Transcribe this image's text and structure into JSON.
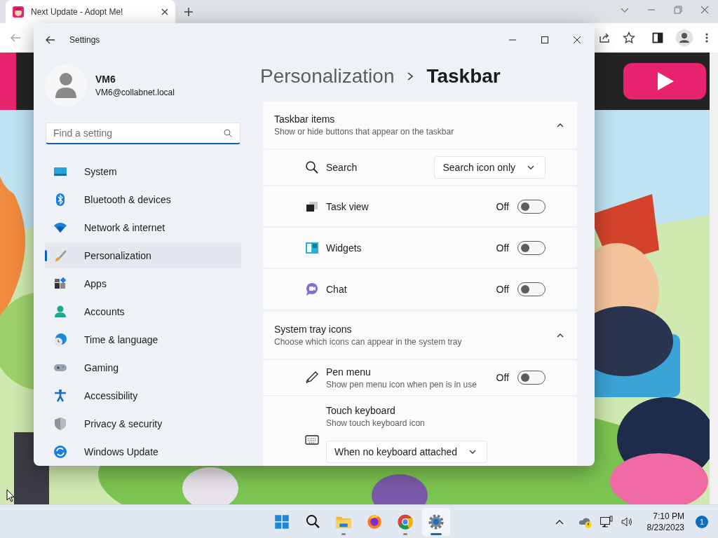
{
  "browser": {
    "tab": {
      "title": "Next Update - Adopt Me!",
      "selected": true
    }
  },
  "settings": {
    "title": "Settings",
    "account": {
      "name": "VM6",
      "email": "VM6@collabnet.local"
    },
    "search": {
      "placeholder": "Find a setting"
    },
    "nav": [
      {
        "label": "System",
        "selected": false
      },
      {
        "label": "Bluetooth & devices",
        "selected": false
      },
      {
        "label": "Network & internet",
        "selected": false
      },
      {
        "label": "Personalization",
        "selected": true
      },
      {
        "label": "Apps",
        "selected": false
      },
      {
        "label": "Accounts",
        "selected": false
      },
      {
        "label": "Time & language",
        "selected": false
      },
      {
        "label": "Gaming",
        "selected": false
      },
      {
        "label": "Accessibility",
        "selected": false
      },
      {
        "label": "Privacy & security",
        "selected": false
      },
      {
        "label": "Windows Update",
        "selected": false
      }
    ],
    "breadcrumb": [
      "Personalization",
      "Taskbar"
    ],
    "sections": [
      {
        "title": "Taskbar items",
        "subtitle": "Show or hide buttons that appear on the taskbar",
        "expanded": true,
        "rows": [
          {
            "kind": "dropdown",
            "label": "Search",
            "value": "Search icon only"
          },
          {
            "kind": "toggle",
            "label": "Task view",
            "state": "Off",
            "on": false
          },
          {
            "kind": "toggle",
            "label": "Widgets",
            "state": "Off",
            "on": false
          },
          {
            "kind": "toggle",
            "label": "Chat",
            "state": "Off",
            "on": false
          }
        ]
      },
      {
        "title": "System tray icons",
        "subtitle": "Choose which icons can appear in the system tray",
        "expanded": true,
        "rows": [
          {
            "kind": "toggle",
            "label": "Pen menu",
            "description": "Show pen menu icon when pen is in use",
            "state": "Off",
            "on": false
          },
          {
            "kind": "dropdown_below",
            "label": "Touch keyboard",
            "description": "Show touch keyboard icon",
            "value": "When no keyboard attached"
          }
        ]
      }
    ]
  },
  "taskbar": {
    "apps": [
      {
        "kind": "start",
        "running": false,
        "selected": false
      },
      {
        "kind": "search",
        "running": false,
        "selected": false
      },
      {
        "kind": "explorer",
        "running": true,
        "selected": false
      },
      {
        "kind": "firefox",
        "running": false,
        "selected": false
      },
      {
        "kind": "chrome",
        "running": true,
        "selected": false
      },
      {
        "kind": "settings",
        "running": true,
        "selected": true
      }
    ],
    "time": "7:10 PM",
    "date": "8/23/2023",
    "notifications": "1"
  }
}
